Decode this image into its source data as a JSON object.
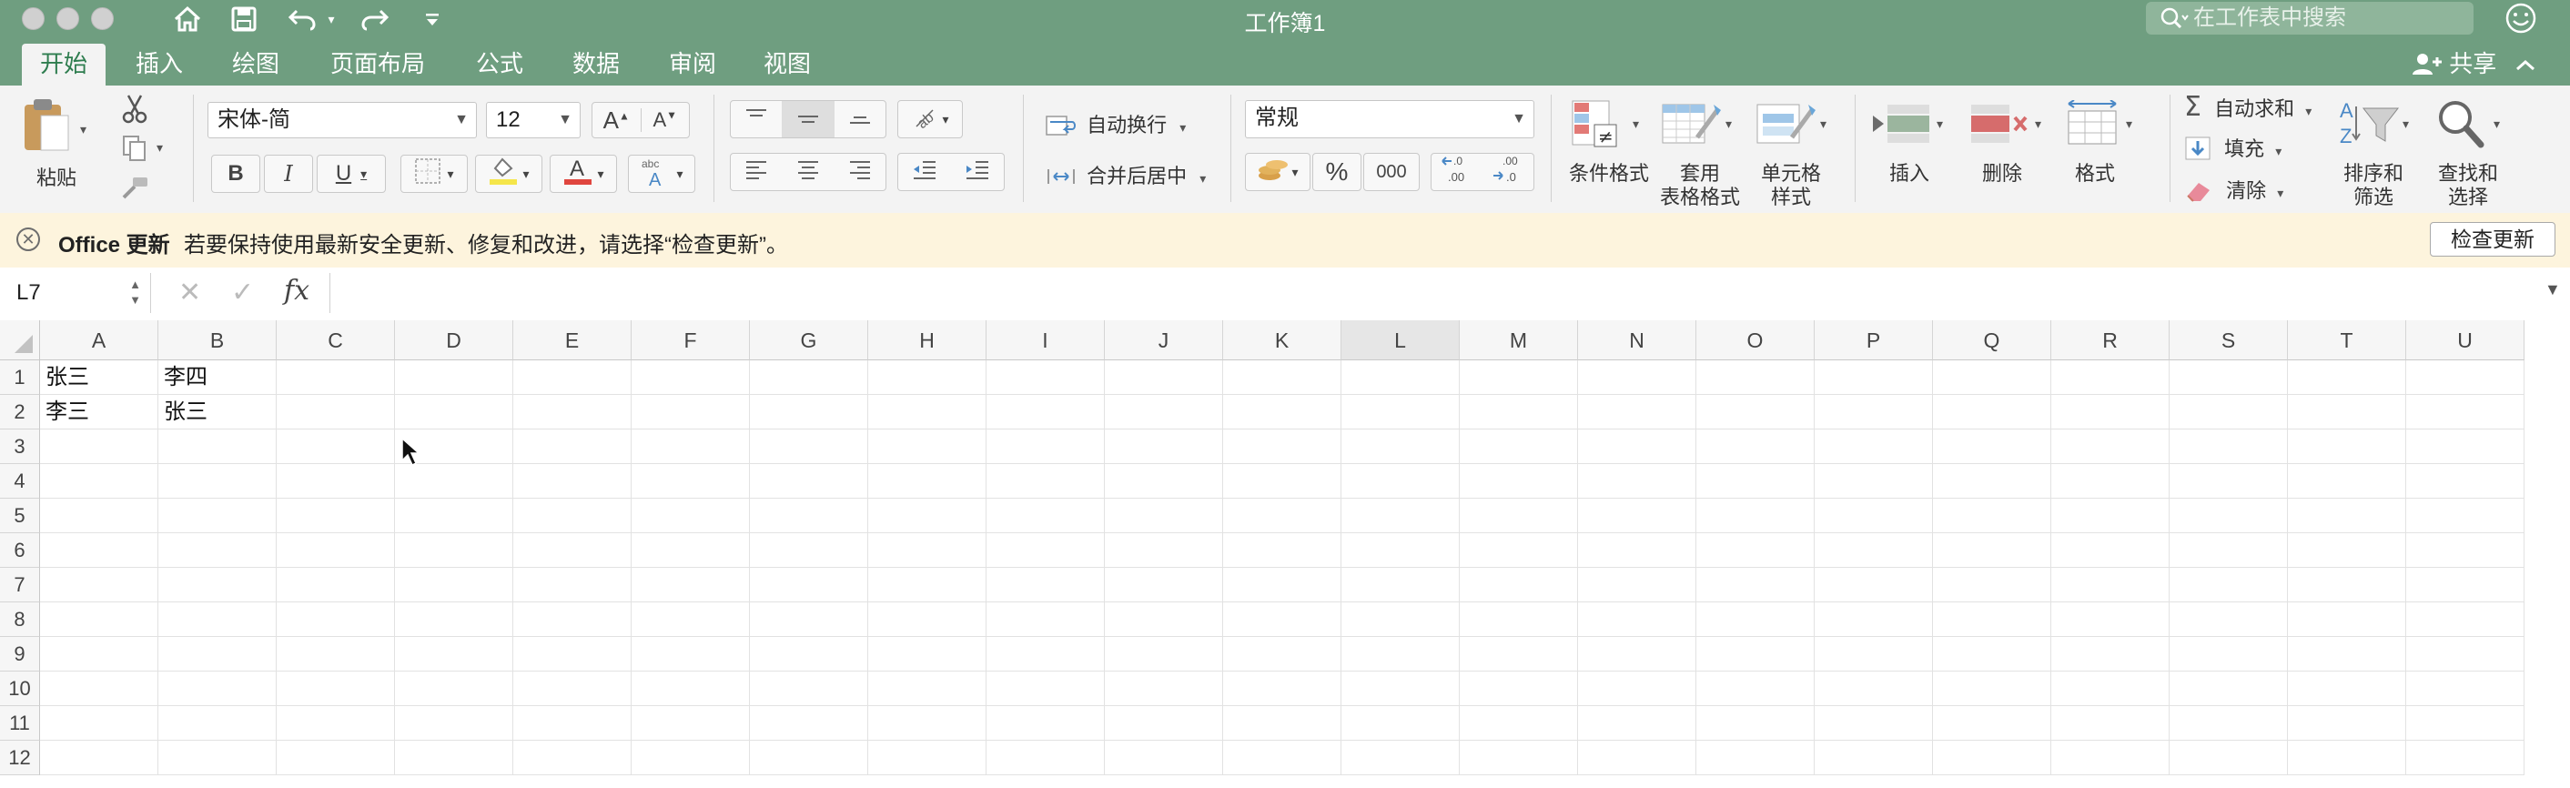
{
  "window": {
    "title": "工作簿1",
    "search_placeholder": "在工作表中搜索"
  },
  "tabs": [
    {
      "label": "开始",
      "active": true
    },
    {
      "label": "插入"
    },
    {
      "label": "绘图"
    },
    {
      "label": "页面布局"
    },
    {
      "label": "公式"
    },
    {
      "label": "数据"
    },
    {
      "label": "审阅"
    },
    {
      "label": "视图"
    }
  ],
  "share_label": "共享",
  "ribbon": {
    "paste_label": "粘贴",
    "font_name": "宋体-简",
    "font_size": "12",
    "bold": "B",
    "italic": "I",
    "underline": "U",
    "wrap_text_label": "自动换行",
    "merge_center_label": "合并后居中",
    "number_format": "常规",
    "percent": "%",
    "thousands": "000",
    "cond_format_label": "条件格式",
    "table_format_label_1": "套用",
    "table_format_label_2": "表格格式",
    "cell_style_label_1": "单元格",
    "cell_style_label_2": "样式",
    "insert_label": "插入",
    "delete_label": "删除",
    "format_label": "格式",
    "autosum_label": "自动求和",
    "fill_label": "填充",
    "clear_label": "清除",
    "sort_label_1": "排序和",
    "sort_label_2": "筛选",
    "find_label_1": "查找和",
    "find_label_2": "选择"
  },
  "notification": {
    "title": "Office 更新",
    "message": "若要保持使用最新安全更新、修复和改进，请选择“检查更新”。",
    "button": "检查更新"
  },
  "formula_bar": {
    "name_box": "L7",
    "fx": "fx",
    "content": ""
  },
  "sheet": {
    "columns": [
      "A",
      "B",
      "C",
      "D",
      "E",
      "F",
      "G",
      "H",
      "I",
      "J",
      "K",
      "L",
      "M",
      "N",
      "O",
      "P",
      "Q",
      "R",
      "S",
      "T",
      "U"
    ],
    "selected_column": "L",
    "rows": [
      "1",
      "2",
      "3",
      "4",
      "5",
      "6",
      "7",
      "8",
      "9",
      "10",
      "11",
      "12"
    ],
    "cells": [
      [
        "张三",
        "李四"
      ],
      [
        "李三",
        "张三"
      ]
    ]
  },
  "colors": {
    "title_bar": "#6f9e80",
    "ribbon": "#f3f3f3",
    "notification": "#fdf4dd",
    "accent": "#2e7d4f"
  }
}
